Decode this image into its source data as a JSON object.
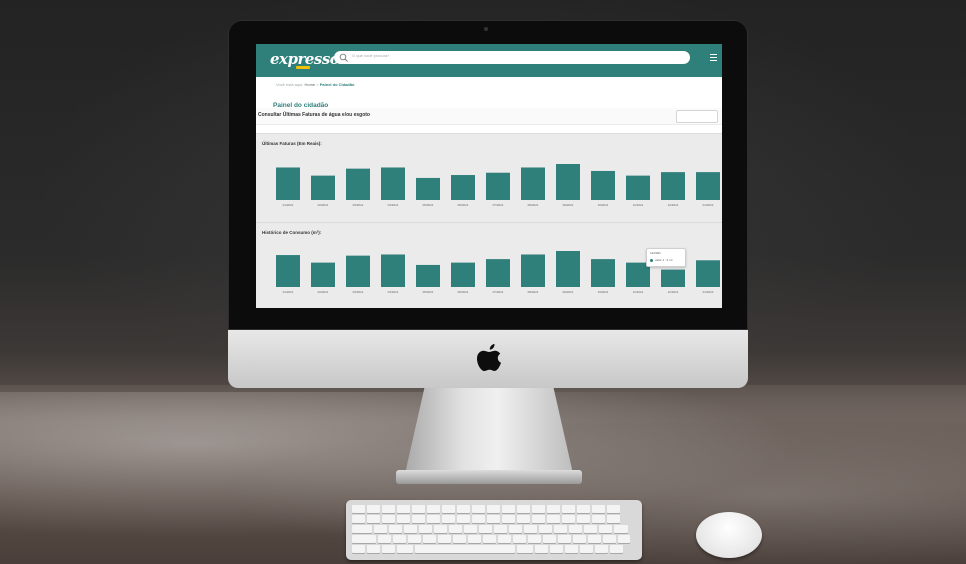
{
  "app": {
    "logo_text": "expresso",
    "search_placeholder": "O que você procura?",
    "accent_color": "#2f7f7b",
    "logo_accent_color": "#f2c200"
  },
  "breadcrumb": {
    "prefix": "Você está aqui:",
    "home": "Home",
    "separator": ">",
    "current": "Painel do Cidadão"
  },
  "page": {
    "title": "Painel do cidadão",
    "consult_label": "Consultar Últimas Faturas de água e/ou esgoto"
  },
  "tooltip": {
    "date": "12/2021",
    "value": "valor 1 : 3 m³"
  },
  "chart_data": [
    {
      "type": "bar",
      "title": "Últimas Faturas (Em Reais):",
      "categories": [
        "01/2021",
        "02/2021",
        "03/2021",
        "04/2021",
        "05/2021",
        "06/2021",
        "07/2021",
        "08/2021",
        "09/2021",
        "10/2021",
        "11/2021",
        "12/2021",
        "01/2022"
      ],
      "values": [
        56,
        42,
        54,
        56,
        38,
        43,
        47,
        56,
        62,
        50,
        42,
        48,
        48
      ]
    },
    {
      "type": "bar",
      "title": "Histórico de Consumo (m³):",
      "categories": [
        "01/2021",
        "02/2021",
        "03/2021",
        "04/2021",
        "05/2021",
        "06/2021",
        "07/2021",
        "08/2021",
        "09/2021",
        "10/2021",
        "11/2021",
        "12/2021",
        "01/2022"
      ],
      "values": [
        5.5,
        4.2,
        5.4,
        5.6,
        3.8,
        4.2,
        4.8,
        5.6,
        6.2,
        4.8,
        4.2,
        3,
        4.6
      ]
    }
  ]
}
